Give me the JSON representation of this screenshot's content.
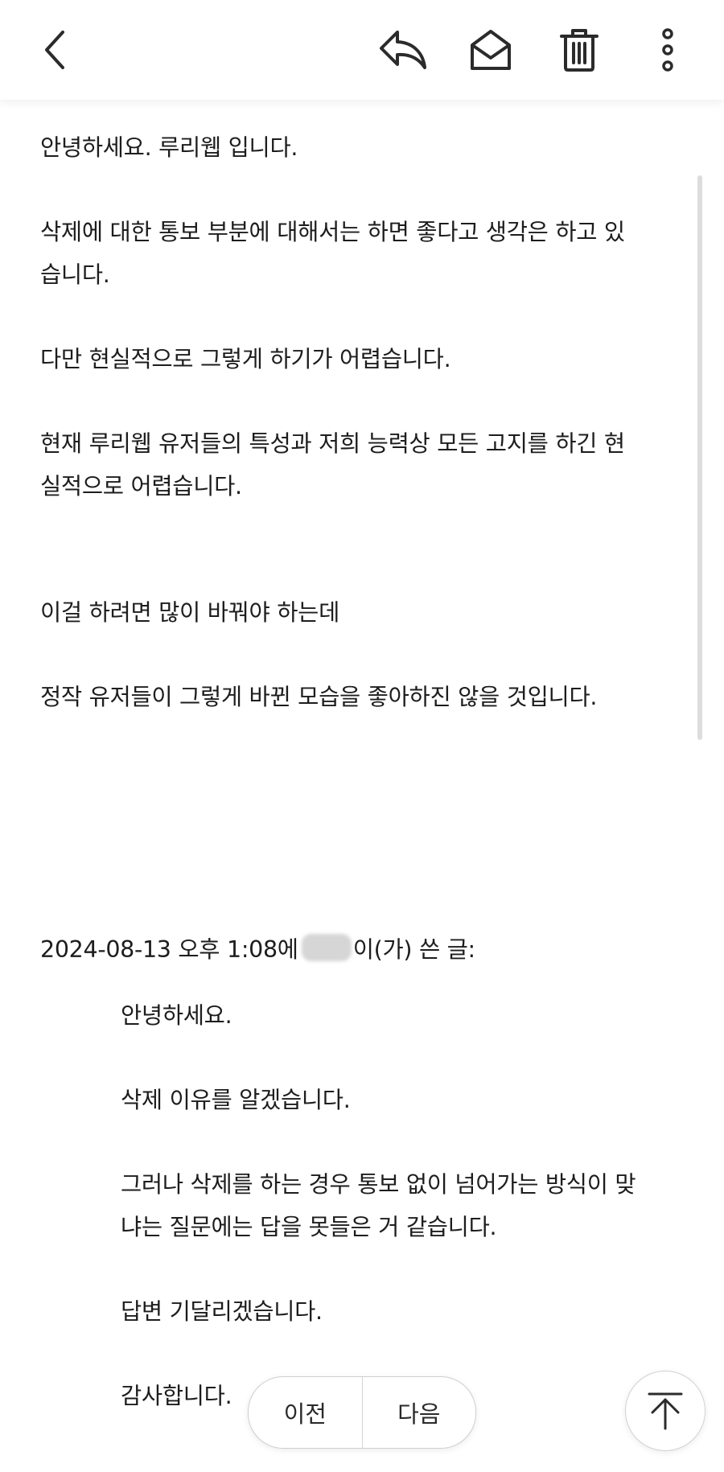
{
  "toolbar": {
    "back_icon": "chevron-left-icon",
    "reply_icon": "reply-icon",
    "mark_unread_icon": "envelope-open-icon",
    "delete_icon": "trash-icon",
    "more_icon": "more-vertical-icon"
  },
  "message": {
    "paragraphs": [
      "안녕하세요. 루리웹 입니다.",
      "삭제에 대한 통보 부분에 대해서는 하면 좋다고 생각은 하고 있",
      "습니다.",
      "다만 현실적으로 그렇게 하기가 어렵습니다.",
      "현재 루리웹 유저들의 특성과 저희 능력상 모든 고지를 하긴 현",
      "실적으로 어렵습니다.",
      "이걸 하려면 많이 바꿔야 하는데",
      "정작 유저들이 그렇게 바뀐 모습을 좋아하진 않을 것입니다."
    ],
    "quote_header_prefix": "2024-08-13 오후 1:08에",
    "quote_header_suffix": "이(가) 쓴 글:"
  },
  "quoted": {
    "lines": [
      "안녕하세요.",
      "삭제 이유를 알겠습니다.",
      "그러나 삭제를 하는 경우 통보 없이 넘어가는 방식이 맞",
      "냐는 질문에는 답을 못들은 거 같습니다.",
      "답변 기달리겠습니다.",
      "감사합니다."
    ]
  },
  "pager": {
    "prev_label": "이전",
    "next_label": "다음"
  },
  "scroll_top_icon": "arrow-up-to-top-icon",
  "colors": {
    "text": "#1d1d1d",
    "icon": "#2b2b2b",
    "scrollbar": "#dddddd",
    "background": "#ffffff"
  }
}
